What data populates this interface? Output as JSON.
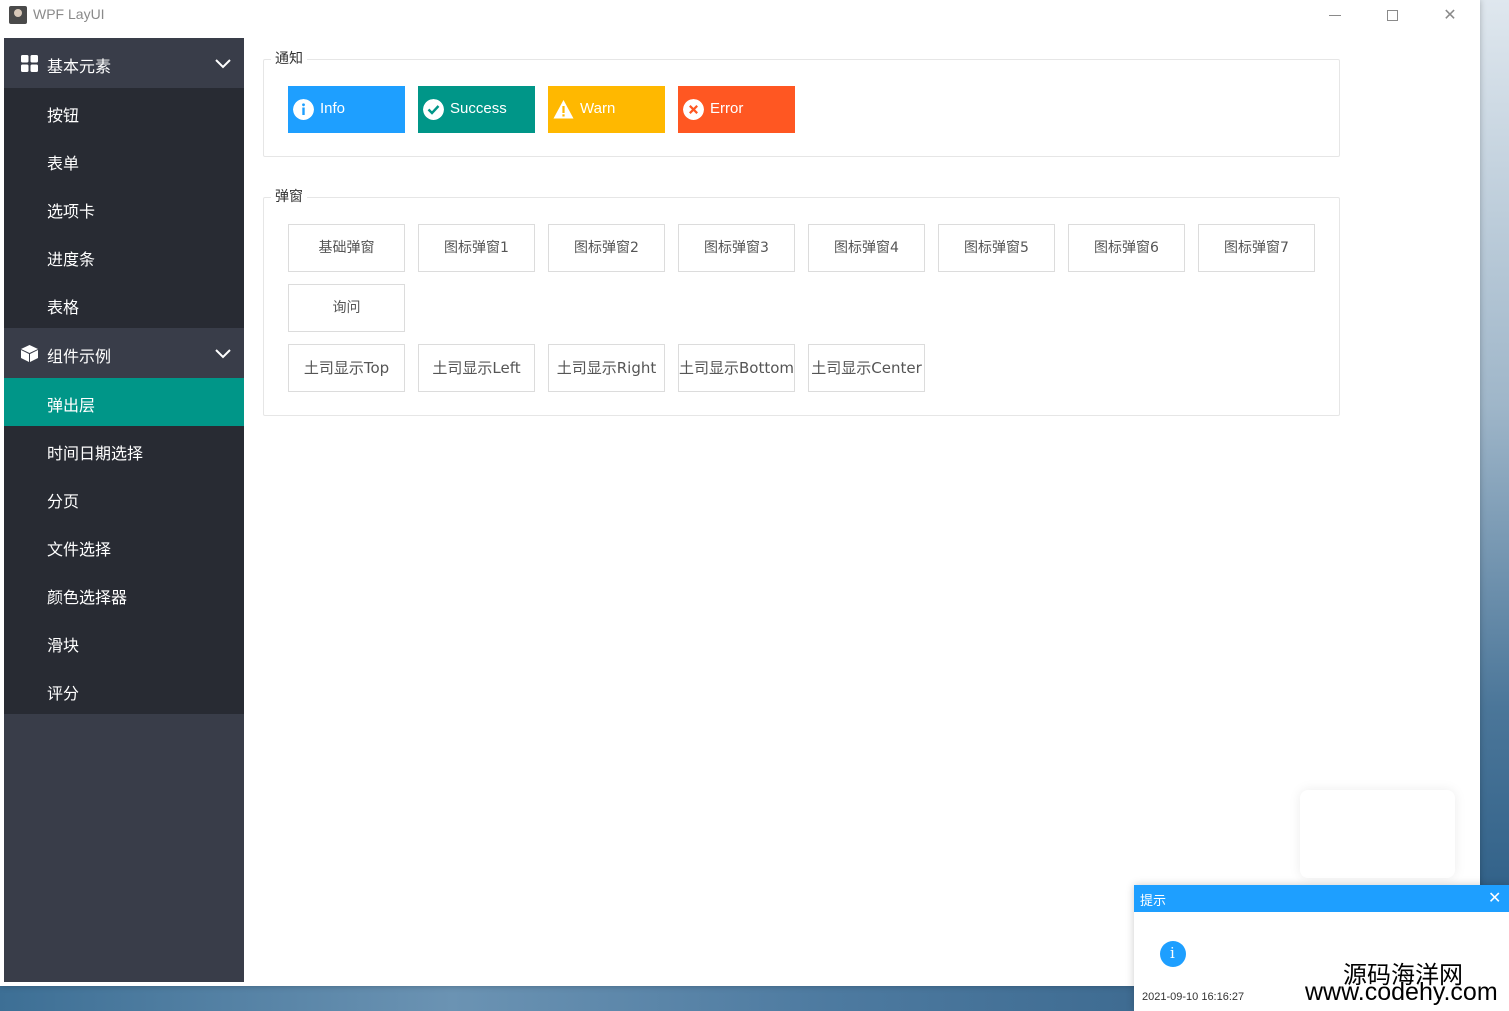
{
  "window": {
    "title": "WPF LayUI"
  },
  "sidebar": {
    "groups": [
      {
        "label": "基本元素",
        "icon": "grid-icon",
        "items": [
          "按钮",
          "表单",
          "选项卡",
          "进度条",
          "表格"
        ]
      },
      {
        "label": "组件示例",
        "icon": "cube-icon",
        "items": [
          "弹出层",
          "时间日期选择",
          "分页",
          "文件选择",
          "颜色选择器",
          "滑块",
          "评分"
        ],
        "active_item": "弹出层"
      }
    ]
  },
  "notice": {
    "legend": "通知",
    "buttons": [
      {
        "label": "Info",
        "icon": "info-icon",
        "color": "#1e9fff"
      },
      {
        "label": "Success",
        "icon": "check-circle-icon",
        "color": "#009688"
      },
      {
        "label": "Warn",
        "icon": "warning-triangle-icon",
        "color": "#ffb800"
      },
      {
        "label": "Error",
        "icon": "error-circle-icon",
        "color": "#ff5722"
      }
    ]
  },
  "popup": {
    "legend": "弹窗",
    "row1": [
      "基础弹窗",
      "图标弹窗1",
      "图标弹窗2",
      "图标弹窗3",
      "图标弹窗4",
      "图标弹窗5",
      "图标弹窗6",
      "图标弹窗7"
    ],
    "row2": [
      "询问"
    ],
    "row3": [
      "土司显示Top",
      "土司显示Left",
      "土司显示Right",
      "土司显示Bottom",
      "土司显示Center"
    ]
  },
  "toast": {
    "title": "提示",
    "time": "2021-09-10 16:16:27"
  },
  "watermark": {
    "cn": "源码海洋网",
    "url": "www.codehy.com"
  },
  "colors": {
    "sidebar_bg": "#393d49",
    "sidebar_sub_bg": "#282b33",
    "active": "#009688",
    "info": "#1e9fff"
  }
}
